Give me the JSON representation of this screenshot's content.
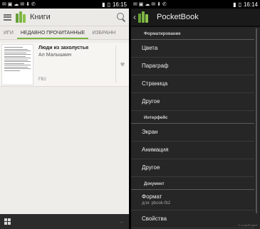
{
  "left": {
    "status_bar": {
      "time": "16:15"
    },
    "app_title": "Книги",
    "tabs": [
      {
        "label": "ИГИ"
      },
      {
        "label": "НЕДАВНО ПРОЧИТАННЫЕ"
      },
      {
        "label": "ИЗБРАНН"
      }
    ],
    "book": {
      "title": "Люди из захолустья",
      "author": "Ал Малышкин",
      "format": "FB2"
    },
    "bottom_text": "..."
  },
  "right": {
    "status_bar": {
      "time": "16:14"
    },
    "app_title": "PocketBook",
    "sections": [
      {
        "title": "Форматирование",
        "items": [
          {
            "label": "Цвета"
          },
          {
            "label": "Параграф"
          },
          {
            "label": "Страница"
          },
          {
            "label": "Другое"
          }
        ]
      },
      {
        "title": "Интерфейс",
        "items": [
          {
            "label": "Экран"
          },
          {
            "label": "Анимация"
          },
          {
            "label": "Другое"
          }
        ]
      },
      {
        "title": "Документ",
        "items": [
          {
            "label": "Формат",
            "sub": "для: pbook-fb2"
          },
          {
            "label": "Свойства"
          }
        ]
      }
    ],
    "watermark": "© ru.fanProject"
  },
  "colors": {
    "accent": "#7cb342",
    "dark_bg": "#262626",
    "light_bg": "#efedea"
  }
}
